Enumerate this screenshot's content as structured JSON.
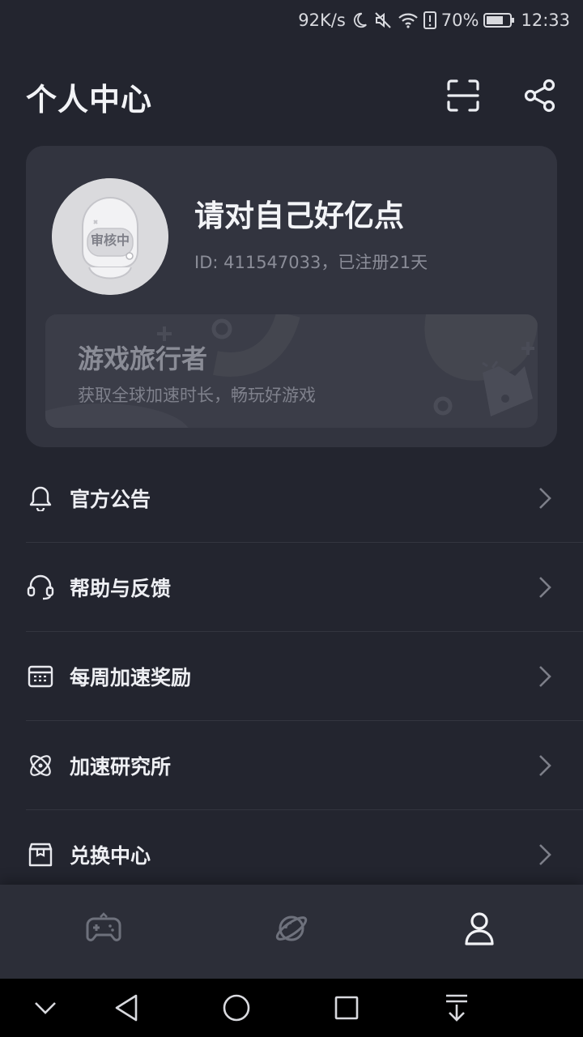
{
  "status_bar": {
    "net_speed": "92K/s",
    "battery": "70%",
    "time": "12:33"
  },
  "header": {
    "title": "个人中心"
  },
  "profile": {
    "name": "请对自己好亿点",
    "id_text": "ID: 411547033，已注册21天",
    "avatar_badge": "审核中"
  },
  "membership": {
    "title": "游戏旅行者",
    "subtitle": "获取全球加速时长，畅玩好游戏"
  },
  "menu": [
    {
      "label": "官方公告",
      "icon": "bell-icon"
    },
    {
      "label": "帮助与反馈",
      "icon": "headset-icon"
    },
    {
      "label": "每周加速奖励",
      "icon": "calendar-icon"
    },
    {
      "label": "加速研究所",
      "icon": "atom-icon"
    },
    {
      "label": "兑换中心",
      "icon": "gift-box-icon"
    }
  ],
  "tabs": [
    {
      "icon": "gamepad-icon",
      "active": false
    },
    {
      "icon": "planet-icon",
      "active": false
    },
    {
      "icon": "user-icon",
      "active": true
    }
  ],
  "colors": {
    "background": "#23252f",
    "card": "#32343f",
    "accent_text": "#f3f4f7",
    "muted": "#8b8d98"
  }
}
